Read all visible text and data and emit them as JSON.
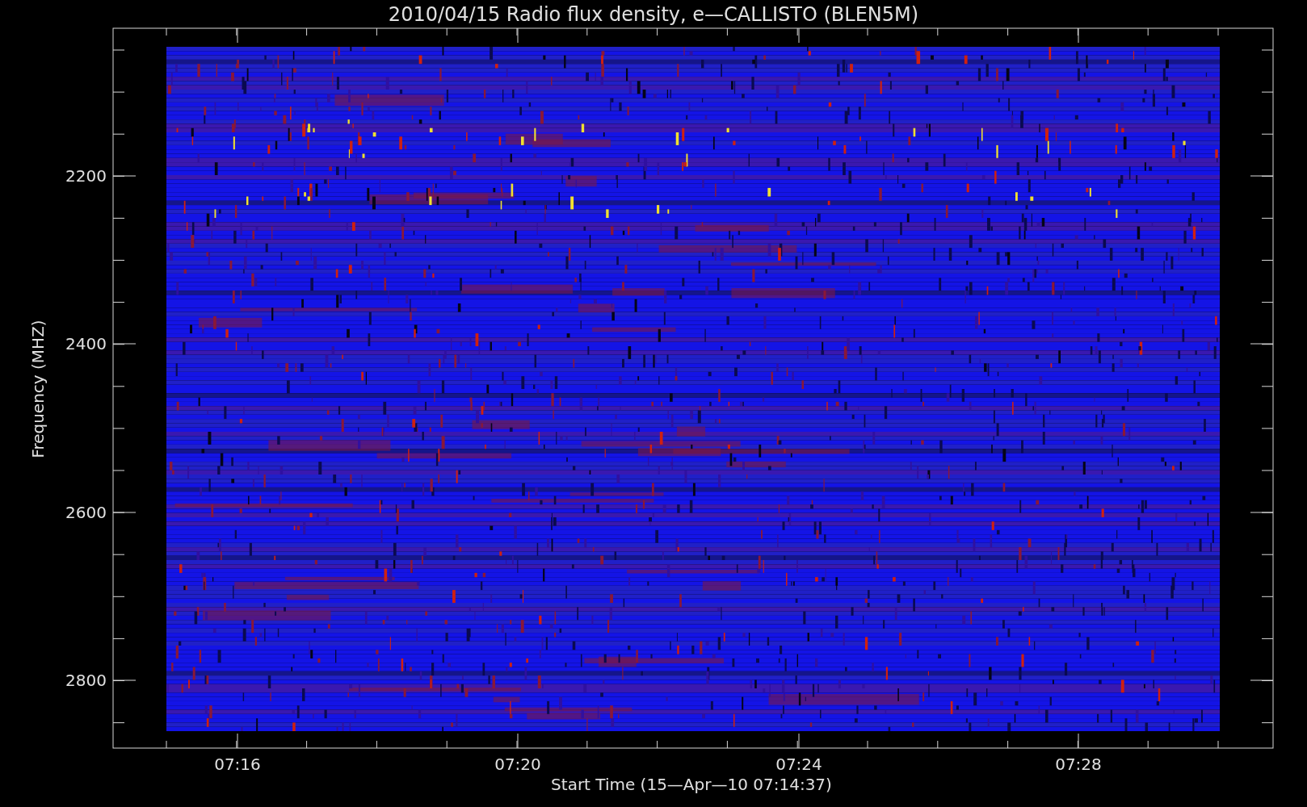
{
  "title": "2010/04/15  Radio flux density, e—CALLISTO (BLEN5M)",
  "x_axis": {
    "label": "Start Time (15—Apr—10 07:14:37)",
    "ticks": [
      "07:16",
      "07:20",
      "07:24",
      "07:28"
    ]
  },
  "y_axis": {
    "label": "Frequency (MHZ)",
    "ticks": [
      "2200",
      "2400",
      "2600",
      "2800"
    ]
  }
}
